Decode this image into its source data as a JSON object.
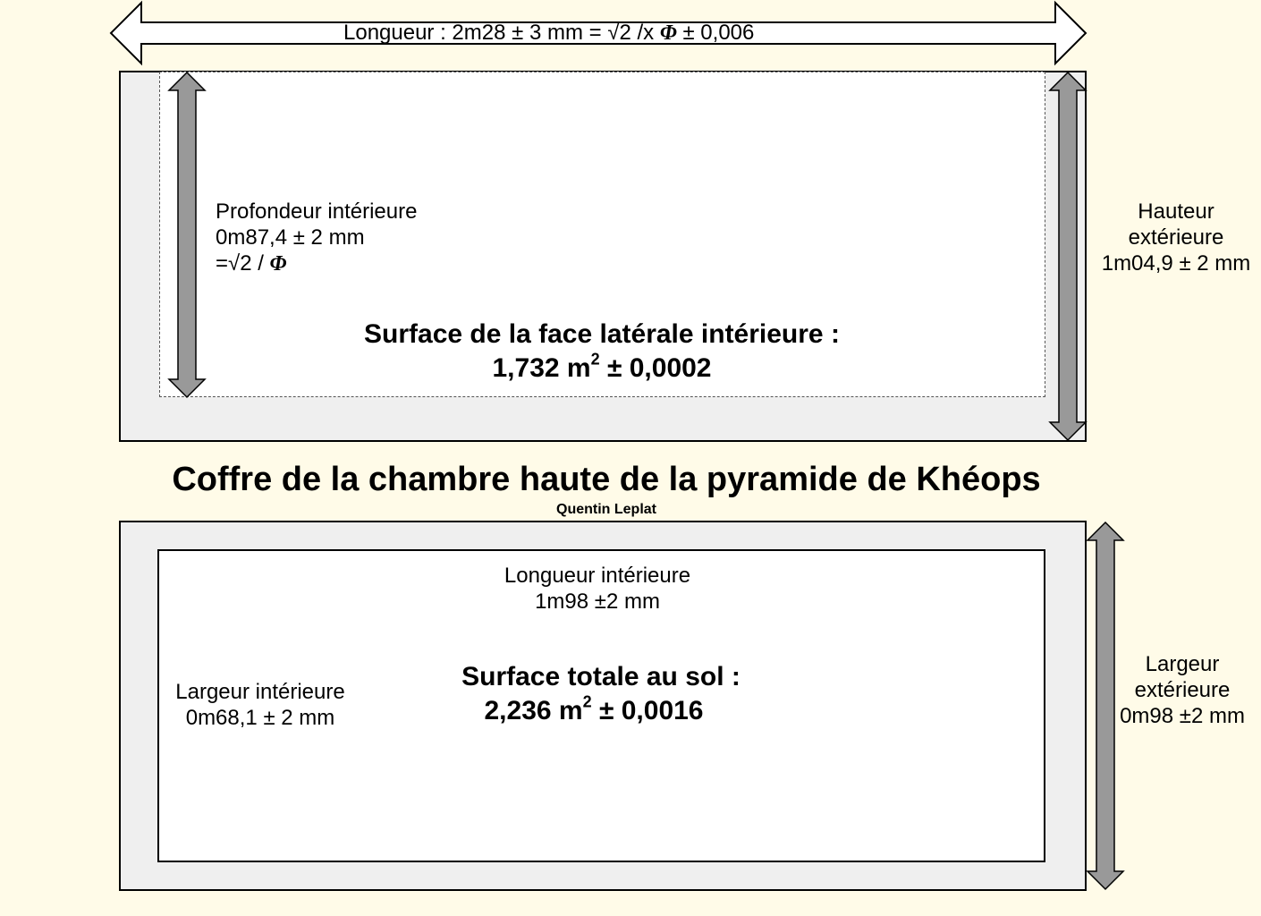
{
  "side_view": {
    "length_label": "Longueur : 2m28 ± 3 mm = √2 /x",
    "length_phi": "Φ",
    "length_tail": "± 0,006",
    "depth_line1": "Profondeur intérieure",
    "depth_line2": "0m87,4 ± 2 mm",
    "depth_line3": "=√2 /",
    "depth_phi": "Φ",
    "height_line1": "Hauteur",
    "height_line2": "extérieure",
    "height_line3": "1m04,9 ± 2 mm",
    "surface_title": "Surface de  la face latérale intérieure :",
    "surface_value": "1,732 m",
    "surface_exp": "2",
    "surface_tol": "± 0,0002"
  },
  "title": "Coffre de la chambre haute de la pyramide de Khéops",
  "author": "Quentin Leplat",
  "top_view": {
    "length_line1": "Longueur intérieure",
    "length_line2": "1m98 ±2 mm",
    "width_line1": "Largeur intérieure",
    "width_line2": "0m68,1 ± 2 mm",
    "ext_width_line1": "Largeur",
    "ext_width_line2": "extérieure",
    "ext_width_line3": "0m98 ±2 mm",
    "surface_title": "Surface totale au sol :",
    "surface_value": "2,236 m",
    "surface_exp": "2",
    "surface_tol": "± 0,0016"
  },
  "colors": {
    "background": "#fffbe8",
    "box_fill": "#efefef",
    "arrow_fill": "#999999"
  }
}
